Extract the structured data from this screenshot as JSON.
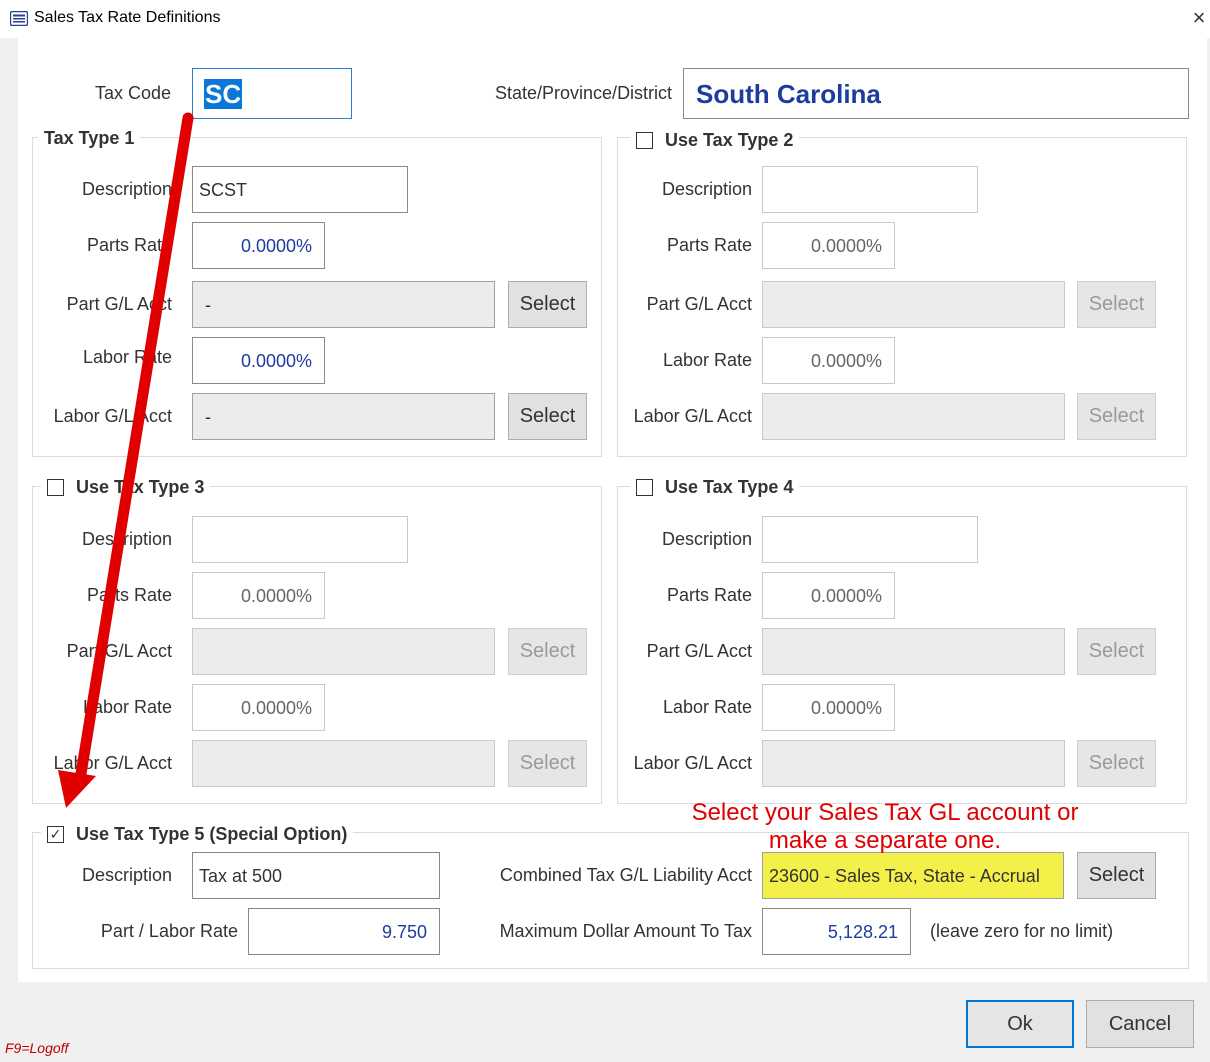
{
  "window": {
    "title": "Sales Tax Rate Definitions",
    "icon": "app-window-icon",
    "close_glyph": "×"
  },
  "header": {
    "tax_code_label": "Tax Code",
    "tax_code_value": "SC",
    "state_label": "State/Province/District",
    "state_value": "South Carolina"
  },
  "tax_types": [
    {
      "title": "Tax Type 1",
      "checkbox": false,
      "description_label": "Description",
      "description_value": "SCST",
      "parts_rate_label": "Parts Rate",
      "parts_rate_value": "0.0000%",
      "part_gl_label": "Part G/L Acct",
      "part_gl_value": "-",
      "labor_rate_label": "Labor Rate",
      "labor_rate_value": "0.0000%",
      "labor_gl_label": "Labor G/L Acct",
      "labor_gl_value": "-",
      "select_label": "Select"
    },
    {
      "title": "Use Tax Type 2",
      "checkbox": true,
      "checked": false,
      "description_label": "Description",
      "description_value": "",
      "parts_rate_label": "Parts Rate",
      "parts_rate_value": "0.0000%",
      "part_gl_label": "Part G/L Acct",
      "part_gl_value": "",
      "labor_rate_label": "Labor Rate",
      "labor_rate_value": "0.0000%",
      "labor_gl_label": "Labor G/L Acct",
      "labor_gl_value": "",
      "select_label": "Select"
    },
    {
      "title": "Use Tax Type 3",
      "checkbox": true,
      "checked": false,
      "description_label": "Description",
      "description_value": "",
      "parts_rate_label": "Parts Rate",
      "parts_rate_value": "0.0000%",
      "part_gl_label": "Part G/L Acct",
      "part_gl_value": "",
      "labor_rate_label": "Labor Rate",
      "labor_rate_value": "0.0000%",
      "labor_gl_label": "Labor G/L Acct",
      "labor_gl_value": "",
      "select_label": "Select"
    },
    {
      "title": "Use Tax Type 4",
      "checkbox": true,
      "checked": false,
      "description_label": "Description",
      "description_value": "",
      "parts_rate_label": "Parts Rate",
      "parts_rate_value": "0.0000%",
      "part_gl_label": "Part G/L Acct",
      "part_gl_value": "",
      "labor_rate_label": "Labor Rate",
      "labor_rate_value": "0.0000%",
      "labor_gl_label": "Labor G/L Acct",
      "labor_gl_value": "",
      "select_label": "Select"
    }
  ],
  "tax_type5": {
    "title": "Use Tax Type 5 (Special Option)",
    "checked": true,
    "check_glyph": "✓",
    "description_label": "Description",
    "description_value": "Tax at 500",
    "rate_label": "Part / Labor Rate",
    "rate_value": "9.750",
    "combined_gl_label": "Combined Tax G/L Liability Acct",
    "combined_gl_value": "23600 - Sales Tax, State - Accrual",
    "select_label": "Select",
    "max_label": "Maximum Dollar Amount To Tax",
    "max_value": "5,128.21",
    "max_hint": "(leave zero for no limit)"
  },
  "annotation": {
    "text_line1": "Select your Sales Tax GL account or",
    "text_line2": "make a separate one.",
    "arrow": "red-arrow",
    "color": "#e00000",
    "highlight_color": "#f3f04a"
  },
  "buttons": {
    "ok": "Ok",
    "cancel": "Cancel"
  },
  "footer": {
    "hotkey": "F9=Logoff"
  }
}
